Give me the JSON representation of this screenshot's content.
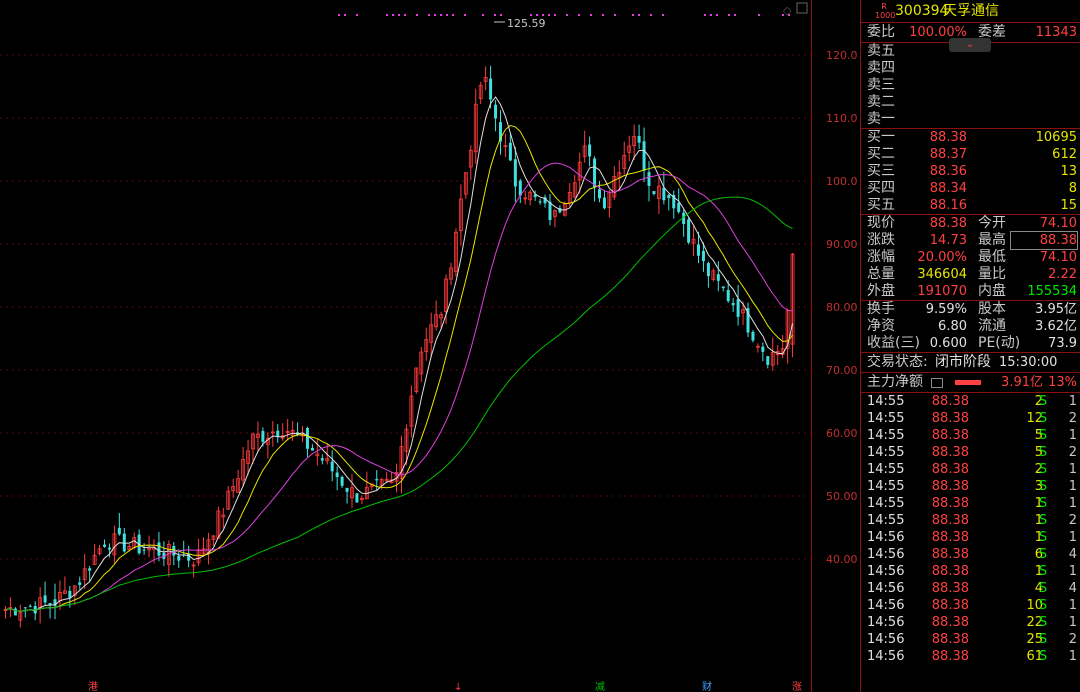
{
  "chart": {
    "peak_label": "125.59",
    "y_ticks": [
      "120.0",
      "110.0",
      "100.0",
      "90.00",
      "80.00",
      "70.00",
      "60.00",
      "50.00",
      "40.00"
    ],
    "bottom_markers": [
      "港",
      "↓",
      "减",
      "财",
      "涨"
    ],
    "colors": {
      "up": "#ff3c3c",
      "down": "#40e0e0",
      "ma5": "#e0e0e0",
      "ma10": "#e6e600",
      "ma20": "#e040e0",
      "ma60": "#00c000",
      "grid": "#5a0a0a",
      "marker_dots": "#e040e0"
    }
  },
  "quote": {
    "code": "300394",
    "name": "天孚通信",
    "logo_text": "R 1000",
    "weibi_label": "委比",
    "weibi_value": "100.00%",
    "weicha_label": "委差",
    "weicha_value": "11343",
    "sells": [
      {
        "label": "卖五",
        "price": "",
        "vol": ""
      },
      {
        "label": "卖四",
        "price": "",
        "vol": ""
      },
      {
        "label": "卖三",
        "price": "",
        "vol": ""
      },
      {
        "label": "卖二",
        "price": "",
        "vol": ""
      },
      {
        "label": "卖一",
        "price": "",
        "vol": ""
      }
    ],
    "buys": [
      {
        "label": "买一",
        "price": "88.38",
        "vol": "10695"
      },
      {
        "label": "买二",
        "price": "88.37",
        "vol": "612"
      },
      {
        "label": "买三",
        "price": "88.36",
        "vol": "13"
      },
      {
        "label": "买四",
        "price": "88.34",
        "vol": "8"
      },
      {
        "label": "买五",
        "price": "88.16",
        "vol": "15"
      }
    ],
    "stats": [
      {
        "l1": "现价",
        "v1": "88.38",
        "c1": "red",
        "l2": "今开",
        "v2": "74.10",
        "c2": "red"
      },
      {
        "l1": "涨跌",
        "v1": "14.73",
        "c1": "red",
        "l2": "最高",
        "v2": "88.38",
        "c2": "red"
      },
      {
        "l1": "涨幅",
        "v1": "20.00%",
        "c1": "red",
        "l2": "最低",
        "v2": "74.10",
        "c2": "red"
      },
      {
        "l1": "总量",
        "v1": "346604",
        "c1": "yellow",
        "l2": "量比",
        "v2": "2.22",
        "c2": "red"
      },
      {
        "l1": "外盘",
        "v1": "191070",
        "c1": "red",
        "l2": "内盘",
        "v2": "155534",
        "c2": "green"
      }
    ],
    "stats2": [
      {
        "l1": "换手",
        "v1": "9.59%",
        "l2": "股本",
        "v2": "3.95亿"
      },
      {
        "l1": "净资",
        "v1": "6.80",
        "l2": "流通",
        "v2": "3.62亿"
      },
      {
        "l1": "收益(三)",
        "v1": "0.600",
        "l2": "PE(动)",
        "v2": "73.9"
      }
    ],
    "trade_state_label": "交易状态:",
    "trade_state_value": "闭市阶段",
    "trade_state_time": "15:30:00",
    "main_flow_label": "主力净额",
    "main_flow_value": "3.91亿",
    "main_flow_pct": "13%"
  },
  "ticks": [
    {
      "t": "14:55",
      "p": "88.38",
      "v": "2",
      "d": "S",
      "n": "1"
    },
    {
      "t": "14:55",
      "p": "88.38",
      "v": "12",
      "d": "S",
      "n": "2"
    },
    {
      "t": "14:55",
      "p": "88.38",
      "v": "5",
      "d": "S",
      "n": "1"
    },
    {
      "t": "14:55",
      "p": "88.38",
      "v": "5",
      "d": "S",
      "n": "2"
    },
    {
      "t": "14:55",
      "p": "88.38",
      "v": "2",
      "d": "S",
      "n": "1"
    },
    {
      "t": "14:55",
      "p": "88.38",
      "v": "3",
      "d": "S",
      "n": "1"
    },
    {
      "t": "14:55",
      "p": "88.38",
      "v": "1",
      "d": "S",
      "n": "1"
    },
    {
      "t": "14:55",
      "p": "88.38",
      "v": "1",
      "d": "S",
      "n": "2"
    },
    {
      "t": "14:56",
      "p": "88.38",
      "v": "1",
      "d": "S",
      "n": "1"
    },
    {
      "t": "14:56",
      "p": "88.38",
      "v": "6",
      "d": "S",
      "n": "4"
    },
    {
      "t": "14:56",
      "p": "88.38",
      "v": "1",
      "d": "S",
      "n": "1"
    },
    {
      "t": "14:56",
      "p": "88.38",
      "v": "4",
      "d": "S",
      "n": "4"
    },
    {
      "t": "14:56",
      "p": "88.38",
      "v": "10",
      "d": "S",
      "n": "1"
    },
    {
      "t": "14:56",
      "p": "88.38",
      "v": "22",
      "d": "S",
      "n": "1"
    },
    {
      "t": "14:56",
      "p": "88.38",
      "v": "25",
      "d": "S",
      "n": "2"
    },
    {
      "t": "14:56",
      "p": "88.38",
      "v": "61",
      "d": "S",
      "n": "1"
    }
  ]
}
